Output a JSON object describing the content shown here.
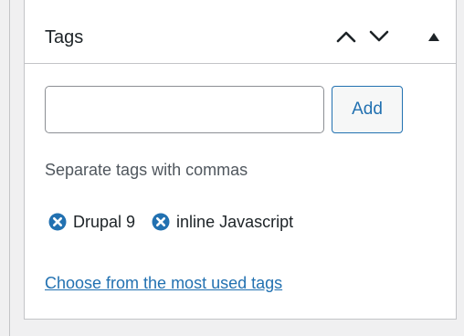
{
  "panel": {
    "title": "Tags",
    "move_up_icon": "chevron-up-icon",
    "move_down_icon": "chevron-down-icon",
    "toggle_icon": "triangle-up-icon"
  },
  "tag_input": {
    "value": "",
    "placeholder": ""
  },
  "add_button_label": "Add",
  "help_text": "Separate tags with commas",
  "tags": [
    {
      "label": "Drupal 9",
      "remove_icon": "remove-circle-x-icon"
    },
    {
      "label": "inline Javascript",
      "remove_icon": "remove-circle-x-icon"
    }
  ],
  "most_used_link": "Choose from the most used tags",
  "colors": {
    "accent": "#2271b1",
    "border": "#c3c4c7",
    "text": "#1d2327",
    "muted_text": "#50575e",
    "background": "#f0f0f1"
  }
}
